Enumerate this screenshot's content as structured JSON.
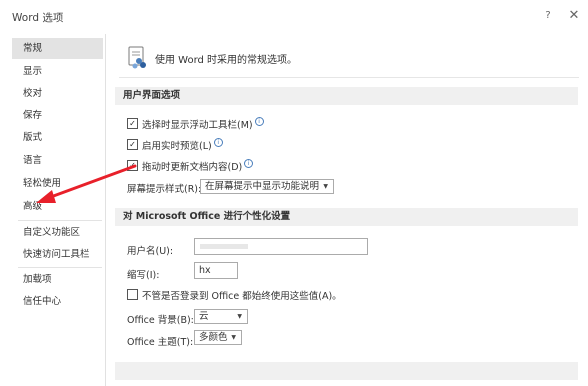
{
  "window": {
    "title": "Word 选项",
    "help_label": "?",
    "close_label": "✕"
  },
  "sidebar": {
    "items": [
      {
        "label": "常规"
      },
      {
        "label": "显示"
      },
      {
        "label": "校对"
      },
      {
        "label": "保存"
      },
      {
        "label": "版式"
      },
      {
        "label": "语言"
      },
      {
        "label": "轻松使用"
      },
      {
        "label": "高级"
      },
      {
        "label": "自定义功能区"
      },
      {
        "label": "快速访问工具栏"
      },
      {
        "label": "加载项"
      },
      {
        "label": "信任中心"
      }
    ],
    "active_index": 0
  },
  "main": {
    "header_text": "使用 Word 时采用的常规选项。",
    "ui_section": {
      "title": "用户界面选项",
      "checkboxes": [
        {
          "label": "选择时显示浮动工具栏(M)",
          "checked": true
        },
        {
          "label": "启用实时预览(L)",
          "checked": true
        },
        {
          "label": "拖动时更新文档内容(D)",
          "checked": true
        }
      ],
      "screentip_label": "屏幕提示样式(R):",
      "screentip_value": "在屏幕提示中显示功能说明"
    },
    "personal_section": {
      "title": "对 Microsoft Office 进行个性化设置",
      "username_label": "用户名(U):",
      "username_value": "",
      "initials_label": "缩写(I):",
      "initials_value": "hx",
      "always_use_label": "不管是否登录到 Office 都始终使用这些值(A)。",
      "always_use_checked": false,
      "background_label": "Office 背景(B):",
      "background_value": "云",
      "theme_label": "Office 主题(T):",
      "theme_value": "多颜色"
    }
  },
  "colors": {
    "annotation_arrow": "#e8202a",
    "info_icon": "#4a7ebb",
    "active_nav": "#e3e3e3"
  }
}
